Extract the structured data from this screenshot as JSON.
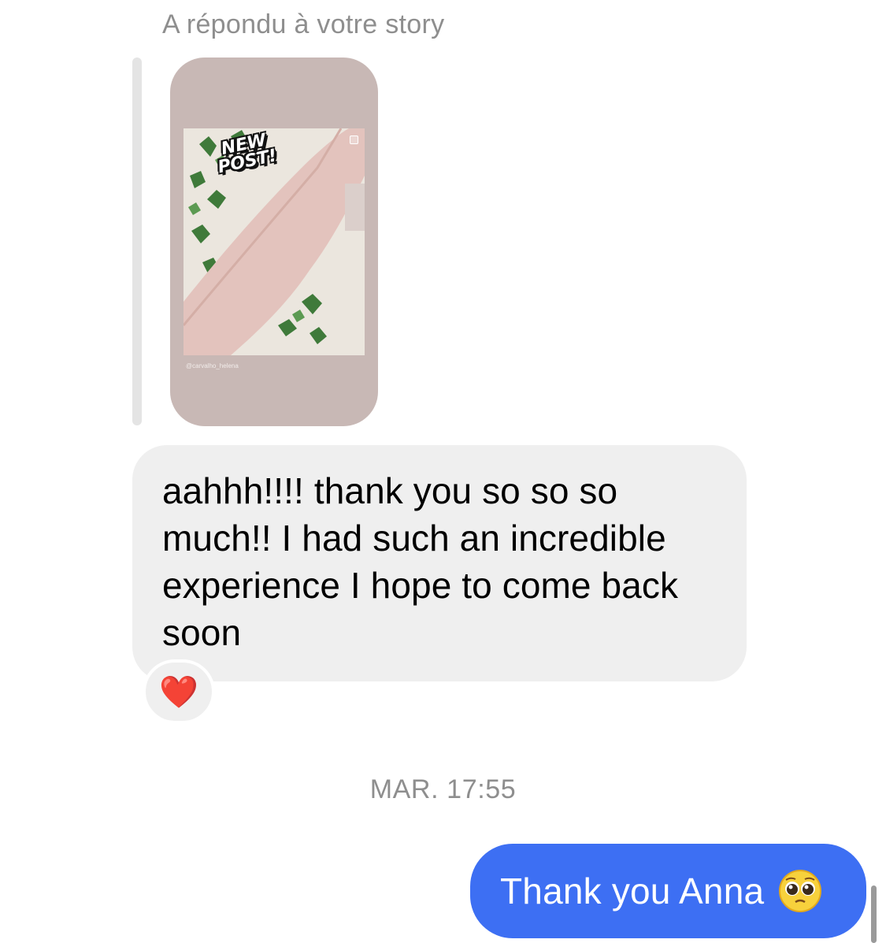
{
  "thread": {
    "reply_label": "A répondu à votre story",
    "story": {
      "sticker_line1": "NEW",
      "sticker_line2": "POST!",
      "handle": "@carvalho_helena",
      "multi_icon": "carousel-icon"
    },
    "incoming_message": {
      "text": "aahhh!!!! thank you so so so much!! I had such an incredible experience I hope to come back soon",
      "reaction": "❤️",
      "reaction_icon": "heart-icon"
    },
    "timestamp": "MAR. 17:55",
    "outgoing_message": {
      "text": "Thank you Anna",
      "emoji_icon": "pleading-face-icon"
    }
  },
  "colors": {
    "incoming_bubble": "#efefef",
    "outgoing_bubble": "#3d6ff3",
    "muted_text": "#8e8e8e",
    "story_background": "#c8b8b5",
    "heart": "#ef2a3b"
  }
}
